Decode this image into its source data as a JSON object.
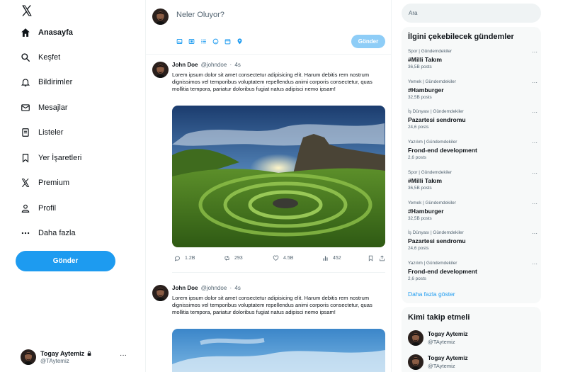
{
  "colors": {
    "accent": "#1d9bf0",
    "accent_disabled": "#8ecdf7",
    "text": "#0f1419",
    "muted": "#536471",
    "panel": "#f7f9f9",
    "divider": "#eff3f4"
  },
  "sidebar": {
    "logo_icon": "x-logo-icon",
    "items": [
      {
        "label": "Anasayfa",
        "icon": "home-icon",
        "active": true
      },
      {
        "label": "Keşfet",
        "icon": "search-icon"
      },
      {
        "label": "Bildirimler",
        "icon": "bell-icon"
      },
      {
        "label": "Mesajlar",
        "icon": "mail-icon"
      },
      {
        "label": "Listeler",
        "icon": "list-icon"
      },
      {
        "label": "Yer İşaretleri",
        "icon": "bookmark-icon"
      },
      {
        "label": "Premium",
        "icon": "x-logo-icon"
      },
      {
        "label": "Profil",
        "icon": "person-icon"
      },
      {
        "label": "Daha fazla",
        "icon": "more-dots-icon"
      }
    ],
    "post_button": "Gönder",
    "account": {
      "name": "Togay Aytemiz",
      "handle": "@TAytemiz",
      "more": "···"
    }
  },
  "compose": {
    "placeholder": "Neler Oluyor?",
    "tools": [
      "image-icon",
      "gif-icon",
      "poll-icon",
      "emoji-icon",
      "schedule-icon",
      "location-icon"
    ],
    "send_label": "Gönder"
  },
  "tweets": [
    {
      "name": "John Doe",
      "handle": "@johndoe",
      "separator": "·",
      "time": "4s",
      "text": "Lorem ipsum dolor sit amet consectetur adipisicing elit. Harum debitis rem nostrum dignissimos vel temporibus voluptatem repellendus animi corporis consectetur, quas mollitia tempora, pariatur doloribus fugiat natus adipisci nemo ipsam!",
      "media": "landscape-photo",
      "replies": "1.2B",
      "retweets": "293",
      "likes": "4.5B",
      "views": "452"
    },
    {
      "name": "John Doe",
      "handle": "@johndoe",
      "separator": "·",
      "time": "4s",
      "text": "Lorem ipsum dolor sit amet consectetur adipisicing elit. Harum debitis rem nostrum dignissimos vel temporibus voluptatem repellendus animi corporis consectetur, quas mollitia tempora, pariatur doloribus fugiat natus adipisci nemo ipsam!",
      "media": "sky-photo"
    }
  ],
  "search": {
    "placeholder": "Ara"
  },
  "trends": {
    "title": "İlgini çekebilecek gündemler",
    "items": [
      {
        "category": "Spor | Gündemdekiler",
        "title": "#Milli Takım",
        "count": "36,5B posts"
      },
      {
        "category": "Yemek | Gündemdekiler",
        "title": "#Hamburger",
        "count": "32,5B posts"
      },
      {
        "category": "İş Dünyası | Gündemdekiler",
        "title": "Pazartesi sendromu",
        "count": "24,6 posts"
      },
      {
        "category": "Yazılım | Gündemdekiler",
        "title": "Frond-end development",
        "count": "2,6 posts"
      },
      {
        "category": "Spor | Gündemdekiler",
        "title": "#Milli Takım",
        "count": "36,5B posts"
      },
      {
        "category": "Yemek | Gündemdekiler",
        "title": "#Hamburger",
        "count": "32,5B posts"
      },
      {
        "category": "İş Dünyası | Gündemdekiler",
        "title": "Pazartesi sendromu",
        "count": "24,6 posts"
      },
      {
        "category": "Yazılım | Gündemdekiler",
        "title": "Frond-end development",
        "count": "2,6 posts"
      }
    ],
    "more_dots": "···",
    "show_more": "Daha fazla göster"
  },
  "who_to_follow": {
    "title": "Kimi takip etmeli",
    "users": [
      {
        "name": "Togay Aytemiz",
        "handle": "@TAytemiz"
      },
      {
        "name": "Togay Aytemiz",
        "handle": "@TAytemiz"
      }
    ]
  }
}
